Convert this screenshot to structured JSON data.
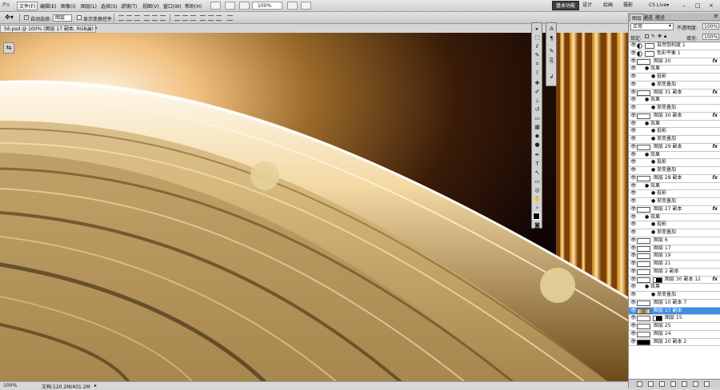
{
  "menubar": {
    "logo": "Ps",
    "menus": [
      "文件(F)",
      "编辑(E)",
      "图像(I)",
      "图层(L)",
      "选择(S)",
      "滤镜(T)",
      "视图(V)",
      "窗口(W)",
      "帮助(H)"
    ],
    "zoom": "100%",
    "workspaces": [
      "基本功能",
      "设计",
      "绘画",
      "摄影"
    ],
    "cs_live": "CS Live▾",
    "window_controls": [
      "–",
      "□",
      "×"
    ]
  },
  "options": {
    "auto_select_label": "自动选择:",
    "auto_select_value": "图层",
    "show_transform_label": "显示变换控件"
  },
  "document": {
    "tab_title": "56.psd @ 100% (图层 17 副本, RGB/8) *",
    "close": "×"
  },
  "status": {
    "zoom": "100%",
    "doc_size": "文档:120.2M/401.2M"
  },
  "panel": {
    "tabs": [
      "图层",
      "通道",
      "路径"
    ],
    "blend_mode": "正常",
    "opacity_label": "不透明度:",
    "opacity": "100%",
    "lock_label": "锁定:",
    "fill_label": "填充:",
    "fill": "100%",
    "layers": [
      {
        "name": "自然饱和度 1",
        "kind": "adj"
      },
      {
        "name": "色彩平衡 1",
        "kind": "adj"
      },
      {
        "name": "图层 20",
        "kind": "layer",
        "fx": "fx"
      },
      {
        "name": "效果",
        "kind": "effects"
      },
      {
        "name": "投影",
        "kind": "effect"
      },
      {
        "name": "渐变叠加",
        "kind": "effect"
      },
      {
        "name": "图层 31 副本",
        "kind": "layer",
        "fx": "fx"
      },
      {
        "name": "效果",
        "kind": "effects"
      },
      {
        "name": "渐变叠加",
        "kind": "effect"
      },
      {
        "name": "图层 30 副本",
        "kind": "layer",
        "fx": "fx"
      },
      {
        "name": "效果",
        "kind": "effects"
      },
      {
        "name": "投影",
        "kind": "effect"
      },
      {
        "name": "渐变叠加",
        "kind": "effect"
      },
      {
        "name": "图层 29 副本",
        "kind": "layer",
        "fx": "fx"
      },
      {
        "name": "效果",
        "kind": "effects"
      },
      {
        "name": "投影",
        "kind": "effect"
      },
      {
        "name": "渐变叠加",
        "kind": "effect"
      },
      {
        "name": "图层 28 副本",
        "kind": "layer",
        "fx": "fx"
      },
      {
        "name": "效果",
        "kind": "effects"
      },
      {
        "name": "投影",
        "kind": "effect"
      },
      {
        "name": "渐变叠加",
        "kind": "effect"
      },
      {
        "name": "图层 27 副本",
        "kind": "layer",
        "fx": "fx"
      },
      {
        "name": "效果",
        "kind": "effects"
      },
      {
        "name": "投影",
        "kind": "effect"
      },
      {
        "name": "渐变叠加",
        "kind": "effect"
      },
      {
        "name": "图层 6",
        "kind": "layer"
      },
      {
        "name": "图层 17",
        "kind": "layer"
      },
      {
        "name": "图层 19",
        "kind": "layer"
      },
      {
        "name": "图层 21",
        "kind": "layer"
      },
      {
        "name": "图层 2 副本",
        "kind": "layer"
      },
      {
        "name": "图层 30 副本 12",
        "kind": "masked",
        "fx": "fx"
      },
      {
        "name": "效果",
        "kind": "effects"
      },
      {
        "name": "渐变叠加",
        "kind": "effect"
      },
      {
        "name": "图层 10 副本 7",
        "kind": "layer"
      },
      {
        "name": "图层 17 副本",
        "kind": "layer",
        "selected": true
      },
      {
        "name": "图层 15",
        "kind": "masked"
      },
      {
        "name": "图层 25",
        "kind": "layer"
      },
      {
        "name": "图层 24",
        "kind": "layer"
      },
      {
        "name": "图层 20 副本 2",
        "kind": "black"
      }
    ]
  }
}
